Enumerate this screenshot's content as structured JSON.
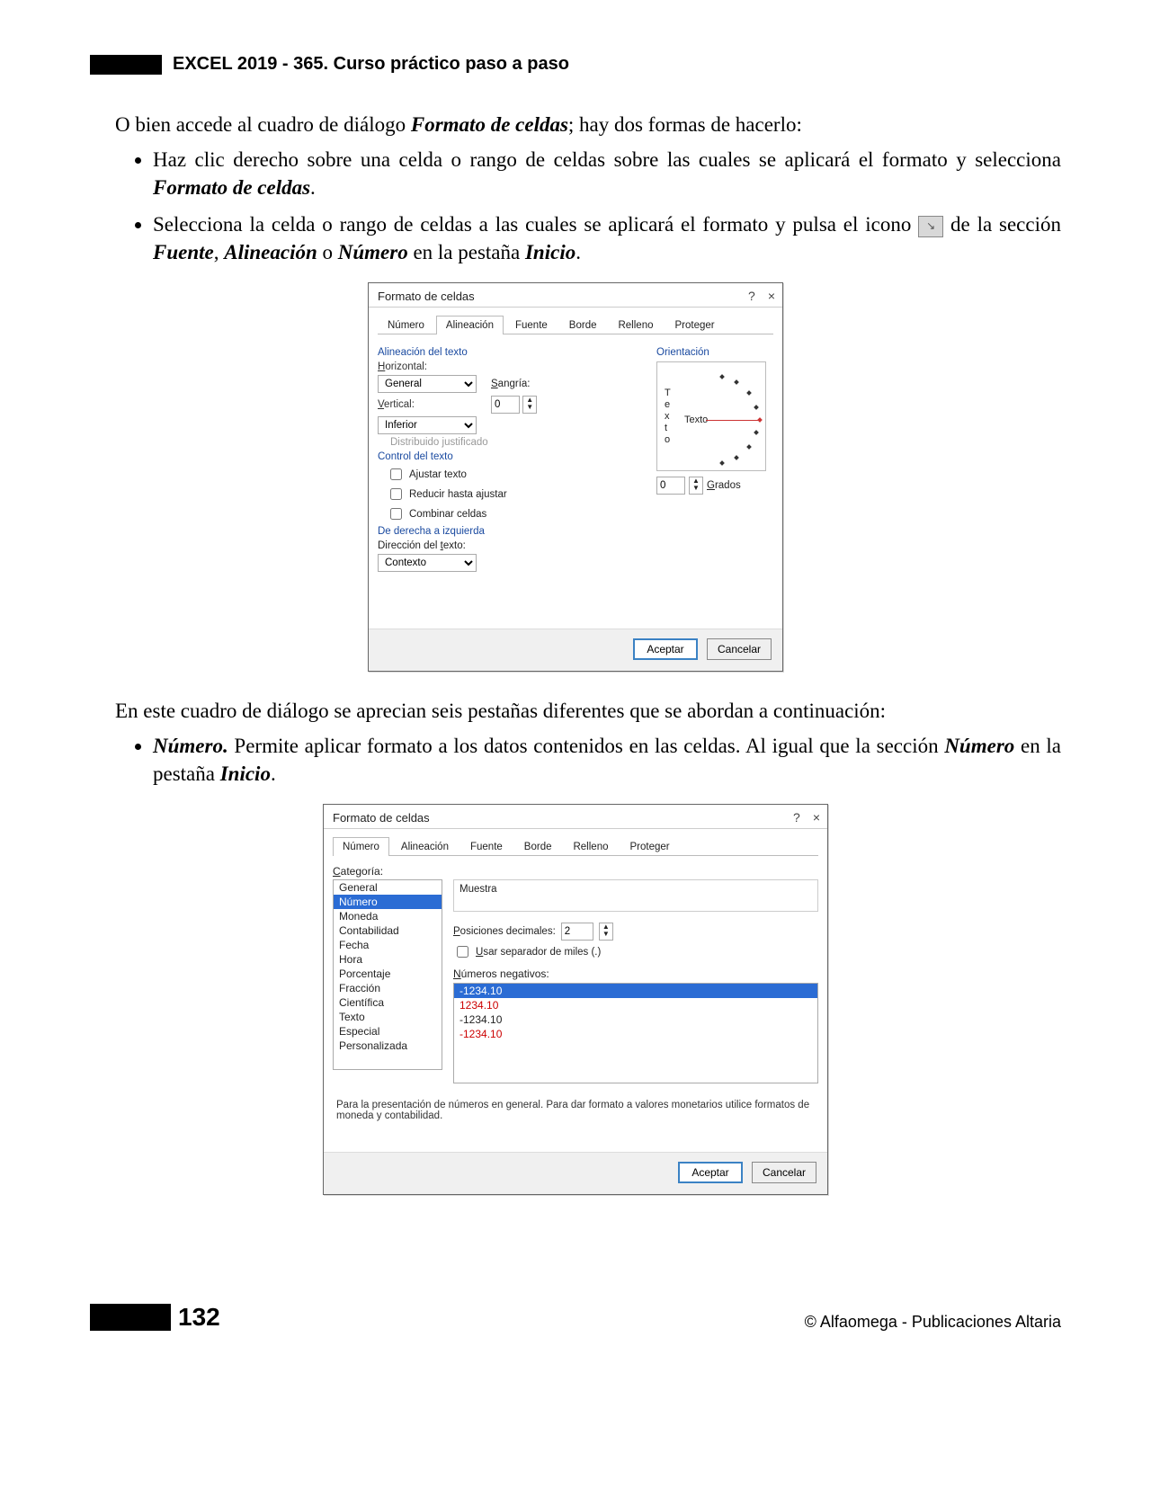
{
  "header": {
    "title": "EXCEL 2019 - 365. Curso práctico paso a paso"
  },
  "intro": {
    "p1a": "O bien accede al cuadro de diálogo ",
    "p1b": "Formato de celdas",
    "p1c": "; hay dos formas de hacerlo:"
  },
  "bullets1": {
    "b1a": "Haz clic derecho sobre una celda o rango de celdas sobre las cuales se aplicará el formato y selecciona ",
    "b1b": "Formato de celdas",
    "b1c": ".",
    "b2a": "Selecciona la celda o rango de celdas a las cuales se aplicará el formato y pulsa el icono ",
    "b2b": " de la sección ",
    "b2c": "Fuente",
    "b2d": ", ",
    "b2e": "Alineación",
    "b2f": " o ",
    "b2g": "Número",
    "b2h": " en la pestaña ",
    "b2i": "Inicio",
    "b2j": "."
  },
  "dialog1": {
    "title": "Formato de celdas",
    "help": "?",
    "close": "×",
    "tabs": [
      "Número",
      "Alineación",
      "Fuente",
      "Borde",
      "Relleno",
      "Proteger"
    ],
    "alignment": {
      "section": "Alineación del texto",
      "horizontal_label": "Horizontal:",
      "horizontal_value": "General",
      "sangria_label": "Sangría:",
      "sangria_value": "0",
      "vertical_label": "Vertical:",
      "vertical_value": "Inferior",
      "dist_label": "Distribuido justificado"
    },
    "control": {
      "section": "Control del texto",
      "c1": "Ajustar texto",
      "c2": "Reducir hasta ajustar",
      "c3": "Combinar celdas"
    },
    "rtl": {
      "section": "De derecha a izquierda",
      "dir_label": "Dirección del texto:",
      "dir_value": "Contexto"
    },
    "orient": {
      "section": "Orientación",
      "texto_v": "T\ne\nx\nt\no",
      "texto_h": "Texto",
      "grados_value": "0",
      "grados_label": "Grados"
    },
    "buttons": {
      "ok": "Aceptar",
      "cancel": "Cancelar"
    }
  },
  "mid": {
    "p2": "En este cuadro de diálogo se aprecian seis pestañas diferentes que se abordan a continuación:",
    "num_label": "Número.",
    "num_text1": " Permite aplicar formato a los datos contenidos en las celdas. Al igual que la sección ",
    "num_bold1": "Número",
    "num_text2": " en la pestaña ",
    "num_bold2": "Inicio",
    "num_text3": "."
  },
  "dialog2": {
    "title": "Formato de celdas",
    "help": "?",
    "close": "×",
    "tabs": [
      "Número",
      "Alineación",
      "Fuente",
      "Borde",
      "Relleno",
      "Proteger"
    ],
    "category_label": "Categoría:",
    "categories": [
      "General",
      "Número",
      "Moneda",
      "Contabilidad",
      "Fecha",
      "Hora",
      "Porcentaje",
      "Fracción",
      "Científica",
      "Texto",
      "Especial",
      "Personalizada"
    ],
    "muestra_label": "Muestra",
    "decimals_label": "Posiciones decimales:",
    "decimals_value": "2",
    "thousands_label": "Usar separador de miles (.)",
    "neg_label": "Números negativos:",
    "neg_values": [
      "-1234.10",
      "1234.10",
      "-1234.10",
      "-1234.10"
    ],
    "desc": "Para la presentación de números en general. Para dar formato a valores monetarios utilice formatos de moneda y contabilidad.",
    "buttons": {
      "ok": "Aceptar",
      "cancel": "Cancelar"
    }
  },
  "footer": {
    "page": "132",
    "copyright": "© Alfaomega - Publicaciones Altaria"
  }
}
